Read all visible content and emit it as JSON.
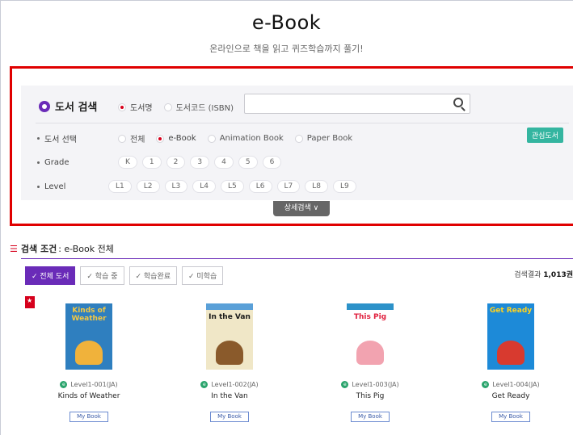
{
  "header": {
    "title": "e-Book",
    "subtitle": "온라인으로 책을 읽고 퀴즈학습까지 풀기!"
  },
  "search": {
    "label": "도서 검색",
    "mode_options": [
      {
        "label": "도서명",
        "selected": true
      },
      {
        "label": "도서코드 (ISBN)",
        "selected": false
      }
    ],
    "input_value": "",
    "input_placeholder": "",
    "book_select_label": "도서 선택",
    "book_types": [
      {
        "label": "전체",
        "selected": false
      },
      {
        "label": "e-Book",
        "selected": true
      },
      {
        "label": "Animation Book",
        "selected": false
      },
      {
        "label": "Paper Book",
        "selected": false
      }
    ],
    "favorite_button": "관심도서",
    "grade_label": "Grade",
    "grades": [
      "K",
      "1",
      "2",
      "3",
      "4",
      "5",
      "6"
    ],
    "level_label": "Level",
    "levels": [
      "L1",
      "L2",
      "L3",
      "L4",
      "L5",
      "L6",
      "L7",
      "L8",
      "L9"
    ],
    "detail_button": "상세검색 ∨"
  },
  "condition": {
    "label": "검색 조건",
    "value": ": e-Book 전체"
  },
  "filters": [
    {
      "label": "✓ 전체 도서",
      "active": true
    },
    {
      "label": "✓ 학습 중",
      "active": false
    },
    {
      "label": "✓ 학습완료",
      "active": false
    },
    {
      "label": "✓ 미학습",
      "active": false
    }
  ],
  "result": {
    "prefix": "검색결과 ",
    "count": "1,013권"
  },
  "books": [
    {
      "cover_title": "Kinds of Weather",
      "code": "Level1-001(JA)",
      "name": "Kinds of Weather",
      "button": "My Book",
      "cover_color": "#2f7fbf",
      "figure_color": "#f0b23b"
    },
    {
      "cover_title": "In the Van",
      "code": "Level1-002(JA)",
      "name": "In the Van",
      "button": "My Book",
      "cover_color": "#5aa0d8",
      "figure_color": "#8a5a2b"
    },
    {
      "cover_title": "This Pig",
      "code": "Level1-003(JA)",
      "name": "This Pig",
      "button": "My Book",
      "cover_color": "#2c92c9",
      "figure_color": "#f2a3b0"
    },
    {
      "cover_title": "Get Ready",
      "code": "Level1-004(JA)",
      "name": "Get Ready",
      "button": "My Book",
      "cover_color": "#1d8ad8",
      "figure_color": "#d83a2f"
    }
  ]
}
